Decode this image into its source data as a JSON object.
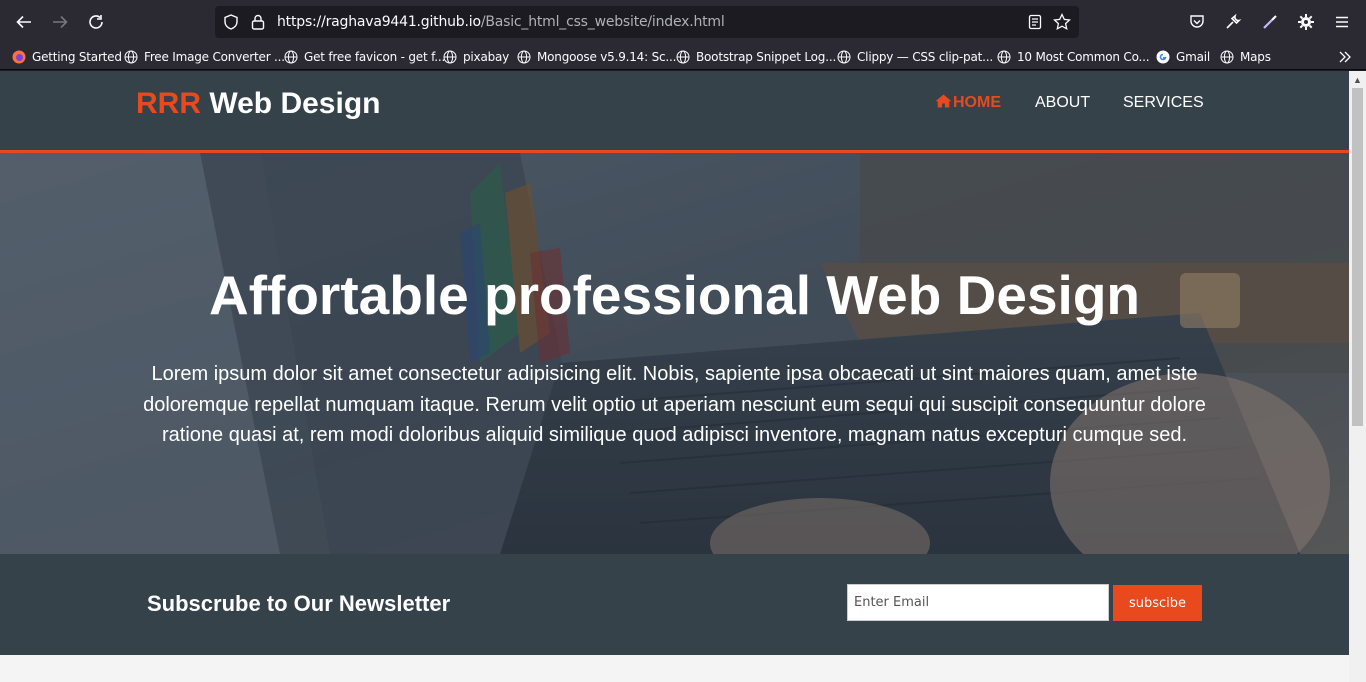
{
  "browser": {
    "url_host": "https://raghava9441.github.io",
    "url_path": "/Basic_html_css_website/index.html",
    "bookmarks": [
      {
        "label": "Getting Started",
        "icon": "firefox-icon"
      },
      {
        "label": "Free Image Converter ...",
        "icon": "globe-icon"
      },
      {
        "label": "Get free favicon - get f...",
        "icon": "globe-icon"
      },
      {
        "label": "pixabay",
        "icon": "globe-icon"
      },
      {
        "label": "Mongoose v5.9.14: Sc...",
        "icon": "globe-icon"
      },
      {
        "label": "Bootstrap Snippet Log...",
        "icon": "globe-icon"
      },
      {
        "label": "Clippy — CSS clip-pat...",
        "icon": "globe-icon"
      },
      {
        "label": "10 Most Common Co...",
        "icon": "globe-icon"
      },
      {
        "label": "Gmail",
        "icon": "google-icon"
      },
      {
        "label": "Maps",
        "icon": "globe-icon"
      }
    ]
  },
  "site": {
    "logo_highlight": "RRR",
    "logo_rest": " Web Design",
    "nav": [
      {
        "label": "HOME",
        "active": true
      },
      {
        "label": "ABOUT",
        "active": false
      },
      {
        "label": "SERVICES",
        "active": false
      }
    ],
    "hero_title": "Affortable professional Web Design",
    "hero_text": "Lorem ipsum dolor sit amet consectetur adipisicing elit. Nobis, sapiente ipsa obcaecati ut sint maiores quam, amet iste doloremque repellat numquam itaque. Rerum velit optio ut aperiam nesciunt eum sequi qui suscipit consequuntur dolore ratione quasi at, rem modi doloribus aliquid similique quod adipisci inventore, magnam natus excepturi cumque sed.",
    "newsletter_title": "Subscrube to Our Newsletter",
    "email_placeholder": "Enter Email",
    "subscribe_label": "subscibe"
  },
  "colors": {
    "accent": "#e8491d",
    "header_bg": "#35424a",
    "browser_bg": "#2b2a33"
  }
}
